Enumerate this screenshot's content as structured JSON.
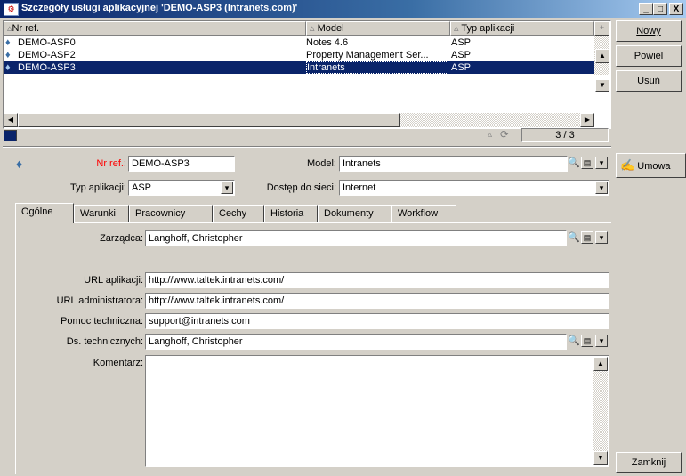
{
  "window": {
    "title": "Szczegóły usługi aplikacyjnej 'DEMO-ASP3 (Intranets.com)'",
    "min": "_",
    "max": "□",
    "close": "X"
  },
  "list": {
    "columns": [
      "Nr ref.",
      "Model",
      "Typ aplikacji"
    ],
    "rows": [
      {
        "ref": "DEMO-ASP0",
        "model": "Notes 4.6",
        "type": "ASP",
        "selected": false
      },
      {
        "ref": "DEMO-ASP2",
        "model": "Property Management Ser...",
        "type": "ASP",
        "selected": false
      },
      {
        "ref": "DEMO-ASP3",
        "model": "Intranets",
        "type": "ASP",
        "selected": true
      }
    ],
    "counter": "3 / 3"
  },
  "side_buttons": {
    "new": "Nowy",
    "duplicate": "Powiel",
    "delete": "Usuń",
    "contract": "Umowa",
    "close": "Zamknij"
  },
  "form": {
    "ref_label": "Nr ref.:",
    "ref_value": "DEMO-ASP3",
    "model_label": "Model:",
    "model_value": "Intranets",
    "type_label": "Typ aplikacji:",
    "type_value": "ASP",
    "network_label": "Dostęp do sieci:",
    "network_value": "Internet"
  },
  "tabs": [
    "Ogólne",
    "Warunki",
    "Pracownicy",
    "Cechy",
    "Historia",
    "Dokumenty",
    "Workflow"
  ],
  "general": {
    "manager_label": "Zarządca:",
    "manager_value": "Langhoff, Christopher",
    "url_app_label": "URL aplikacji:",
    "url_app_value": "http://www.taltek.intranets.com/",
    "url_admin_label": "URL administratora:",
    "url_admin_value": "http://www.taltek.intranets.com/",
    "support_label": "Pomoc techniczna:",
    "support_value": "support@intranets.com",
    "tech_label": "Ds. technicznych:",
    "tech_value": "Langhoff, Christopher",
    "comment_label": "Komentarz:",
    "comment_value": ""
  },
  "colors": {
    "title_start": "#0a246a",
    "selection": "#0a246a",
    "required_label": "#ff0000"
  }
}
